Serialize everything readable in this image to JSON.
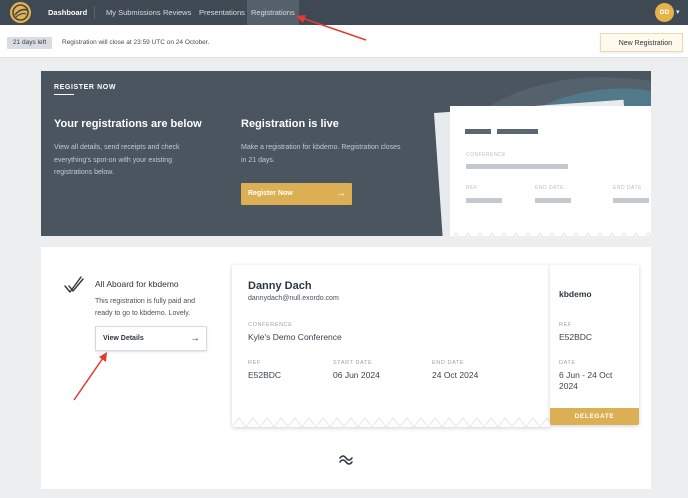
{
  "nav": {
    "brand": "Dashboard",
    "items": [
      "My Submissions",
      "Reviews",
      "Presentations",
      "Registrations"
    ],
    "avatar_initials": "DD"
  },
  "notice": {
    "badge": "21 days left",
    "text": "Registration will close at 23:59 UTC on 24 October.",
    "new_registration": "New Registration"
  },
  "hero": {
    "eyebrow": "REGISTER NOW",
    "left_title": "Your registrations are below",
    "left_text": "View all details, send receipts and check everything's spot-on with your existing registrations below.",
    "right_title": "Registration is live",
    "right_text": "Make a registration for kbdemo. Registration closes in 21 days.",
    "register_button": "Register Now",
    "ticket_labels": {
      "conference": "CONFERENCE",
      "ref": "REF",
      "end_date": "END DATE",
      "end_date_2": "END DATE"
    }
  },
  "registration": {
    "title": "All Aboard for kbdemo",
    "text": "This registration is fully paid and ready to go to kbdemo. Lovely.",
    "view_details": "View Details",
    "ticket": {
      "name": "Danny Dach",
      "email": "dannydach@null.exordo.com",
      "conference_label": "CONFERENCE",
      "conference": "Kyle's Demo Conference",
      "ref_label": "REF",
      "ref": "E52BDC",
      "start_label": "START DATE",
      "start": "06 Jun 2024",
      "end_label": "END DATE",
      "end": "24 Oct 2024"
    },
    "stub": {
      "title": "kbdemo",
      "ref_label": "REF",
      "ref": "E52BDC",
      "date_label": "DATE",
      "date": "6 Jun - 24 Oct 2024",
      "delegate": "DELEGATE"
    }
  },
  "colors": {
    "nav": "#3f4954",
    "accent": "#dcaf55",
    "hero": "#4a5560",
    "annotation": "#e53935"
  }
}
